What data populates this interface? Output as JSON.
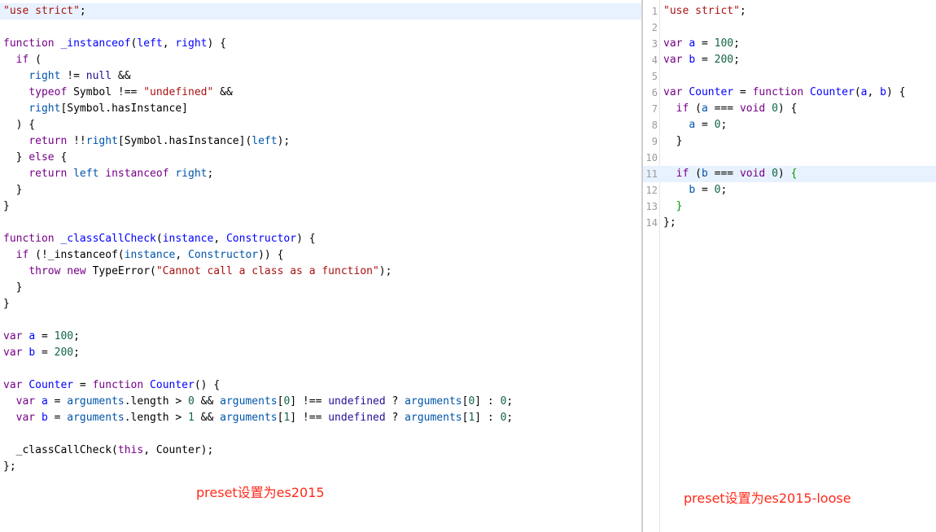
{
  "colors": {
    "keyword": "#770088",
    "def": "#0000ff",
    "variable": "#000000",
    "string": "#aa1111",
    "number": "#116644",
    "atom": "#221199",
    "variable2": "#0055aa",
    "bracket_match": "#009900",
    "line_highlight": "#e8f2fe",
    "caption": "#ff2a1a"
  },
  "left_editor": {
    "caption": "preset设置为es2015",
    "highlighted_line": 0,
    "lines": [
      [
        [
          "\"use strict\"",
          "str"
        ],
        [
          ";",
          "punct"
        ]
      ],
      [],
      [
        [
          "function",
          "kw"
        ],
        [
          " ",
          "ws"
        ],
        [
          "_instanceof",
          "def"
        ],
        [
          "(",
          "punct"
        ],
        [
          "left",
          "def"
        ],
        [
          ", ",
          "punct"
        ],
        [
          "right",
          "def"
        ],
        [
          ") {",
          "punct"
        ]
      ],
      [
        [
          "  ",
          "ws"
        ],
        [
          "if",
          "kw"
        ],
        [
          " (",
          "punct"
        ]
      ],
      [
        [
          "    ",
          "ws"
        ],
        [
          "right",
          "var2"
        ],
        [
          " != ",
          "op"
        ],
        [
          "null",
          "atom"
        ],
        [
          " &&",
          "op"
        ]
      ],
      [
        [
          "    ",
          "ws"
        ],
        [
          "typeof",
          "kw"
        ],
        [
          " Symbol !== ",
          "var"
        ],
        [
          "\"undefined\"",
          "str"
        ],
        [
          " &&",
          "op"
        ]
      ],
      [
        [
          "    ",
          "ws"
        ],
        [
          "right",
          "var2"
        ],
        [
          "[Symbol.hasInstance]",
          "var"
        ]
      ],
      [
        [
          "  ) {",
          "punct"
        ]
      ],
      [
        [
          "    ",
          "ws"
        ],
        [
          "return",
          "kw"
        ],
        [
          " !!",
          "op"
        ],
        [
          "right",
          "var2"
        ],
        [
          "[Symbol.hasInstance](",
          "var"
        ],
        [
          "left",
          "var2"
        ],
        [
          ");",
          "punct"
        ]
      ],
      [
        [
          "  } ",
          "punct"
        ],
        [
          "else",
          "kw"
        ],
        [
          " {",
          "punct"
        ]
      ],
      [
        [
          "    ",
          "ws"
        ],
        [
          "return",
          "kw"
        ],
        [
          " ",
          "ws"
        ],
        [
          "left",
          "var2"
        ],
        [
          " ",
          "ws"
        ],
        [
          "instanceof",
          "kw"
        ],
        [
          " ",
          "ws"
        ],
        [
          "right",
          "var2"
        ],
        [
          ";",
          "punct"
        ]
      ],
      [
        [
          "  }",
          "punct"
        ]
      ],
      [
        [
          "}",
          "punct"
        ]
      ],
      [],
      [
        [
          "function",
          "kw"
        ],
        [
          " ",
          "ws"
        ],
        [
          "_classCallCheck",
          "def"
        ],
        [
          "(",
          "punct"
        ],
        [
          "instance",
          "def"
        ],
        [
          ", ",
          "punct"
        ],
        [
          "Constructor",
          "def"
        ],
        [
          ") {",
          "punct"
        ]
      ],
      [
        [
          "  ",
          "ws"
        ],
        [
          "if",
          "kw"
        ],
        [
          " (!_instanceof(",
          "var"
        ],
        [
          "instance",
          "var2"
        ],
        [
          ", ",
          "punct"
        ],
        [
          "Constructor",
          "var2"
        ],
        [
          ")) {",
          "punct"
        ]
      ],
      [
        [
          "    ",
          "ws"
        ],
        [
          "throw",
          "kw"
        ],
        [
          " ",
          "ws"
        ],
        [
          "new",
          "kw"
        ],
        [
          " TypeError(",
          "var"
        ],
        [
          "\"Cannot call a class as a function\"",
          "str"
        ],
        [
          ");",
          "punct"
        ]
      ],
      [
        [
          "  }",
          "punct"
        ]
      ],
      [
        [
          "}",
          "punct"
        ]
      ],
      [],
      [
        [
          "var",
          "kw"
        ],
        [
          " ",
          "ws"
        ],
        [
          "a",
          "def"
        ],
        [
          " = ",
          "op"
        ],
        [
          "100",
          "num"
        ],
        [
          ";",
          "punct"
        ]
      ],
      [
        [
          "var",
          "kw"
        ],
        [
          " ",
          "ws"
        ],
        [
          "b",
          "def"
        ],
        [
          " = ",
          "op"
        ],
        [
          "200",
          "num"
        ],
        [
          ";",
          "punct"
        ]
      ],
      [],
      [
        [
          "var",
          "kw"
        ],
        [
          " ",
          "ws"
        ],
        [
          "Counter",
          "def"
        ],
        [
          " = ",
          "op"
        ],
        [
          "function",
          "kw"
        ],
        [
          " ",
          "ws"
        ],
        [
          "Counter",
          "def"
        ],
        [
          "() {",
          "punct"
        ]
      ],
      [
        [
          "  ",
          "ws"
        ],
        [
          "var",
          "kw"
        ],
        [
          " ",
          "ws"
        ],
        [
          "a",
          "def"
        ],
        [
          " = ",
          "op"
        ],
        [
          "arguments",
          "var2"
        ],
        [
          ".length > ",
          "var"
        ],
        [
          "0",
          "num"
        ],
        [
          " && ",
          "op"
        ],
        [
          "arguments",
          "var2"
        ],
        [
          "[",
          "punct"
        ],
        [
          "0",
          "num"
        ],
        [
          "] !== ",
          "op"
        ],
        [
          "undefined",
          "atom"
        ],
        [
          " ? ",
          "op"
        ],
        [
          "arguments",
          "var2"
        ],
        [
          "[",
          "punct"
        ],
        [
          "0",
          "num"
        ],
        [
          "] : ",
          "op"
        ],
        [
          "0",
          "num"
        ],
        [
          ";",
          "punct"
        ]
      ],
      [
        [
          "  ",
          "ws"
        ],
        [
          "var",
          "kw"
        ],
        [
          " ",
          "ws"
        ],
        [
          "b",
          "def"
        ],
        [
          " = ",
          "op"
        ],
        [
          "arguments",
          "var2"
        ],
        [
          ".length > ",
          "var"
        ],
        [
          "1",
          "num"
        ],
        [
          " && ",
          "op"
        ],
        [
          "arguments",
          "var2"
        ],
        [
          "[",
          "punct"
        ],
        [
          "1",
          "num"
        ],
        [
          "] !== ",
          "op"
        ],
        [
          "undefined",
          "atom"
        ],
        [
          " ? ",
          "op"
        ],
        [
          "arguments",
          "var2"
        ],
        [
          "[",
          "punct"
        ],
        [
          "1",
          "num"
        ],
        [
          "] : ",
          "op"
        ],
        [
          "0",
          "num"
        ],
        [
          ";",
          "punct"
        ]
      ],
      [],
      [
        [
          "  _classCallCheck(",
          "var"
        ],
        [
          "this",
          "kw"
        ],
        [
          ", Counter);",
          "var"
        ]
      ],
      [
        [
          "};",
          "punct"
        ]
      ]
    ]
  },
  "right_editor": {
    "caption": "preset设置为es2015-loose",
    "highlighted_line": 10,
    "lines": [
      {
        "n": "1",
        "t": [
          [
            "\"use strict\"",
            "str"
          ],
          [
            ";",
            "punct"
          ]
        ]
      },
      {
        "n": "2",
        "t": []
      },
      {
        "n": "3",
        "t": [
          [
            "var",
            "kw"
          ],
          [
            " ",
            "ws"
          ],
          [
            "a",
            "def"
          ],
          [
            " = ",
            "op"
          ],
          [
            "100",
            "num"
          ],
          [
            ";",
            "punct"
          ]
        ]
      },
      {
        "n": "4",
        "t": [
          [
            "var",
            "kw"
          ],
          [
            " ",
            "ws"
          ],
          [
            "b",
            "def"
          ],
          [
            " = ",
            "op"
          ],
          [
            "200",
            "num"
          ],
          [
            ";",
            "punct"
          ]
        ]
      },
      {
        "n": "5",
        "t": []
      },
      {
        "n": "6",
        "t": [
          [
            "var",
            "kw"
          ],
          [
            " ",
            "ws"
          ],
          [
            "Counter",
            "def"
          ],
          [
            " = ",
            "op"
          ],
          [
            "function",
            "kw"
          ],
          [
            " ",
            "ws"
          ],
          [
            "Counter",
            "def"
          ],
          [
            "(",
            "punct"
          ],
          [
            "a",
            "def"
          ],
          [
            ", ",
            "punct"
          ],
          [
            "b",
            "def"
          ],
          [
            ") {",
            "punct"
          ]
        ]
      },
      {
        "n": "7",
        "t": [
          [
            "  ",
            "ws"
          ],
          [
            "if",
            "kw"
          ],
          [
            " (",
            "punct"
          ],
          [
            "a",
            "var2"
          ],
          [
            " === ",
            "op"
          ],
          [
            "void",
            "kw"
          ],
          [
            " ",
            "ws"
          ],
          [
            "0",
            "num"
          ],
          [
            ") {",
            "punct"
          ]
        ]
      },
      {
        "n": "8",
        "t": [
          [
            "    ",
            "ws"
          ],
          [
            "a",
            "var2"
          ],
          [
            " = ",
            "op"
          ],
          [
            "0",
            "num"
          ],
          [
            ";",
            "punct"
          ]
        ]
      },
      {
        "n": "9",
        "t": [
          [
            "  }",
            "punct"
          ]
        ]
      },
      {
        "n": "10",
        "t": []
      },
      {
        "n": "11",
        "t": [
          [
            "  ",
            "ws"
          ],
          [
            "if",
            "kw"
          ],
          [
            " (",
            "punct"
          ],
          [
            "b",
            "var2"
          ],
          [
            " === ",
            "op"
          ],
          [
            "void",
            "kw"
          ],
          [
            " ",
            "ws"
          ],
          [
            "0",
            "num"
          ],
          [
            ") ",
            "punct"
          ],
          [
            "{",
            "brm"
          ]
        ]
      },
      {
        "n": "12",
        "t": [
          [
            "    ",
            "ws"
          ],
          [
            "b",
            "var2"
          ],
          [
            " = ",
            "op"
          ],
          [
            "0",
            "num"
          ],
          [
            ";",
            "punct"
          ]
        ]
      },
      {
        "n": "13",
        "t": [
          [
            "  ",
            "ws"
          ],
          [
            "}",
            "brm"
          ]
        ]
      },
      {
        "n": "14",
        "t": [
          [
            "};",
            "punct"
          ]
        ]
      }
    ]
  }
}
